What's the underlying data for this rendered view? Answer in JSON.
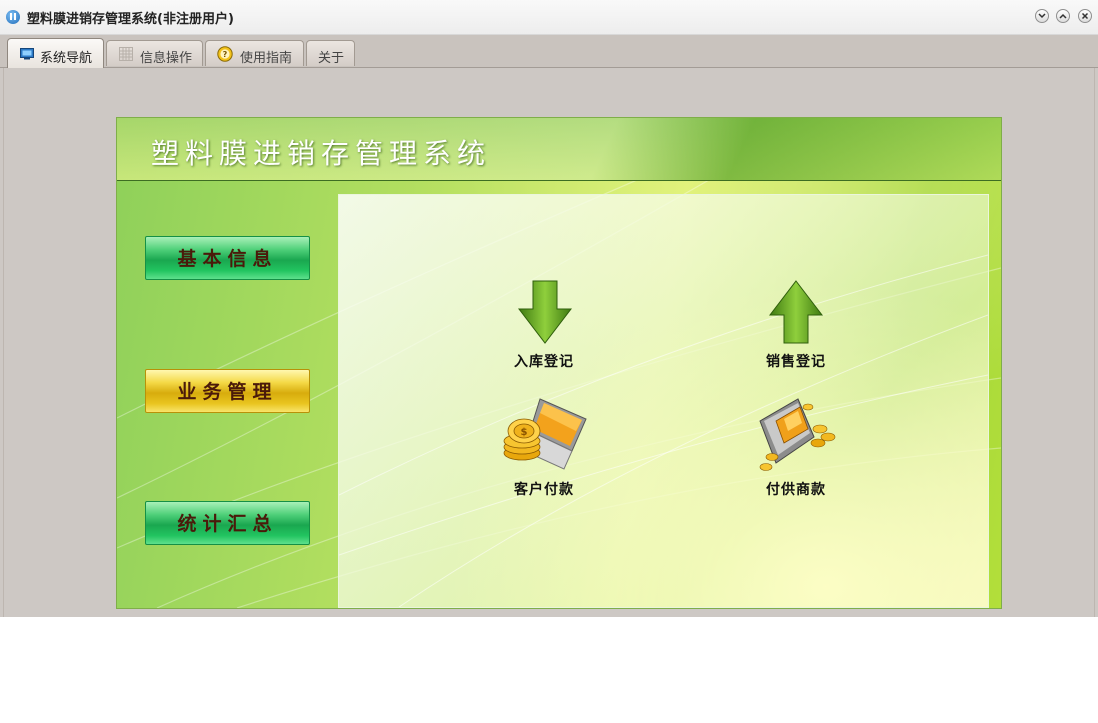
{
  "window": {
    "title": "塑料膜进销存管理系统(非注册用户)",
    "controls": [
      "minimize",
      "maximize",
      "close"
    ]
  },
  "tabs": [
    {
      "label": "系统导航",
      "icon": "monitor-icon",
      "active": true
    },
    {
      "label": "信息操作",
      "icon": "grid-icon",
      "active": false
    },
    {
      "label": "使用指南",
      "icon": "help-icon",
      "active": false
    },
    {
      "label": "关于",
      "icon": "",
      "active": false
    }
  ],
  "panel": {
    "title": "塑料膜进销存管理系统"
  },
  "sidebar": {
    "buttons": [
      {
        "label": "基本信息",
        "style": "green"
      },
      {
        "label": "业务管理",
        "style": "yellow"
      },
      {
        "label": "统计汇总",
        "style": "green"
      }
    ]
  },
  "actions": [
    {
      "label": "入库登记",
      "icon": "arrow-down-icon"
    },
    {
      "label": "销售登记",
      "icon": "arrow-up-icon"
    },
    {
      "label": "客户付款",
      "icon": "coins-laptop-icon"
    },
    {
      "label": "付供商款",
      "icon": "coins-building-icon"
    }
  ],
  "colors": {
    "panel_green": "#9fd43a",
    "button_green": "#1aa74f",
    "button_yellow": "#d7ac0d",
    "arrow_green": "#4f8f1c"
  }
}
